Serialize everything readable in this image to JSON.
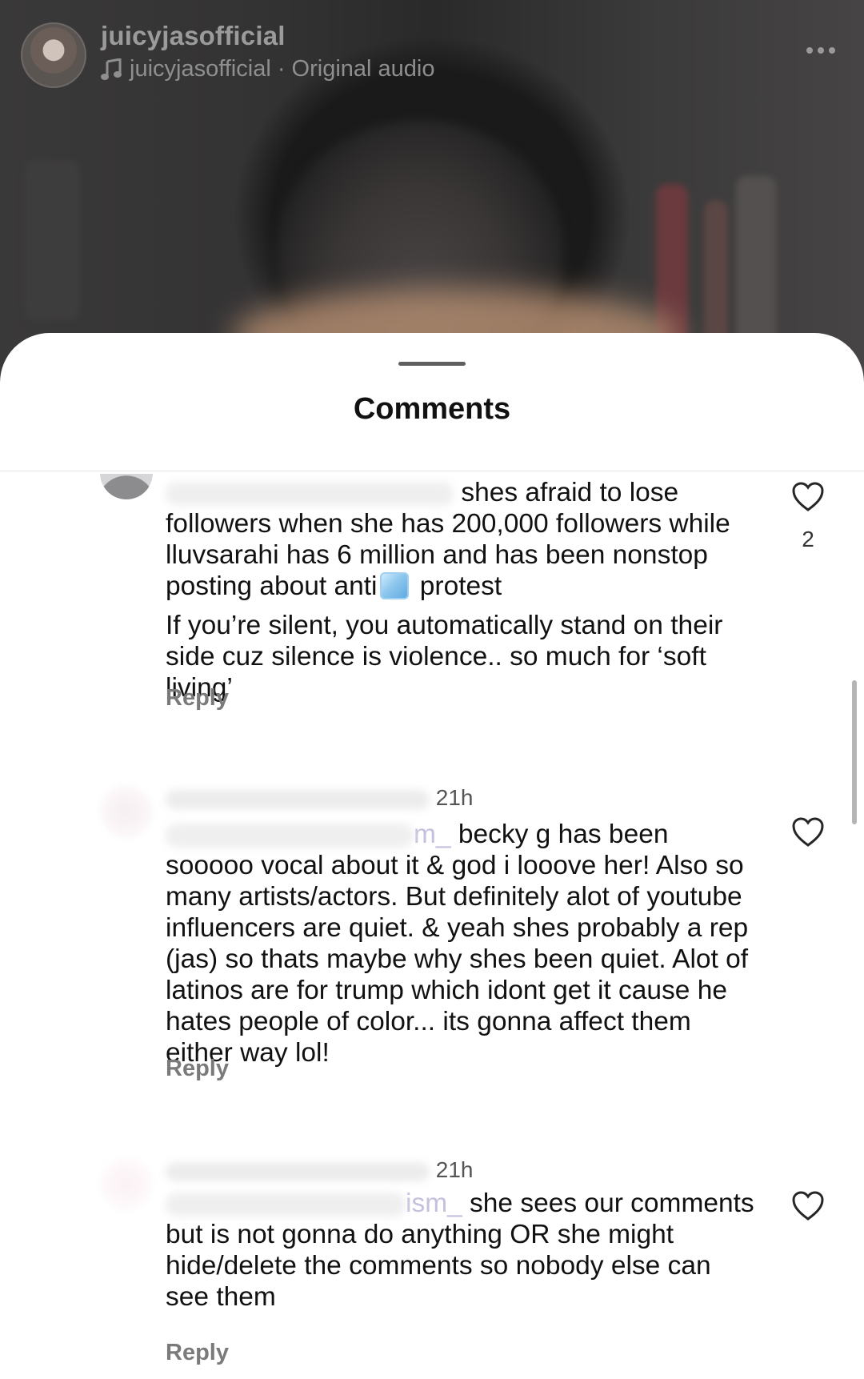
{
  "header": {
    "username": "juicyjasofficial",
    "audio_label": "juicyjasofficial · Original audio"
  },
  "sheet": {
    "title": "Comments"
  },
  "comments": [
    {
      "time": "",
      "mention_tail": "",
      "lines_first": "shes afraid to lose followers when she has 200,000 followers while lluvsarahi has 6 million and has been nonstop posting about anti",
      "lines_after_emoji": "protest",
      "emoji_icon": "ice-cube-icon",
      "paragraph2": "If you’re silent, you automatically stand on their side cuz silence is violence.. so much for ‘soft living’",
      "reply_label": "Reply",
      "likes": "2"
    },
    {
      "time": "21h",
      "mention_tail": "m_",
      "text": "becky g has been sooooo vocal about it & god i looove her! Also so many artists/actors. But definitely alot of youtube influencers are quiet. & yeah shes probably a rep (jas) so thats maybe why shes been quiet. Alot of latinos are for trump which idont get it cause he hates people of color... its gonna affect them either way lol!",
      "reply_label": "Reply"
    },
    {
      "time": "21h",
      "mention_tail": "ism_",
      "text": "she sees our comments but is not gonna do anything OR she might hide/delete the comments so nobody else can see them",
      "reply_label": "Reply"
    }
  ],
  "colors": {
    "sheet_bg": "#ffffff",
    "reply_text": "#7a7a7a",
    "mention_text": "#c5c0dd"
  }
}
